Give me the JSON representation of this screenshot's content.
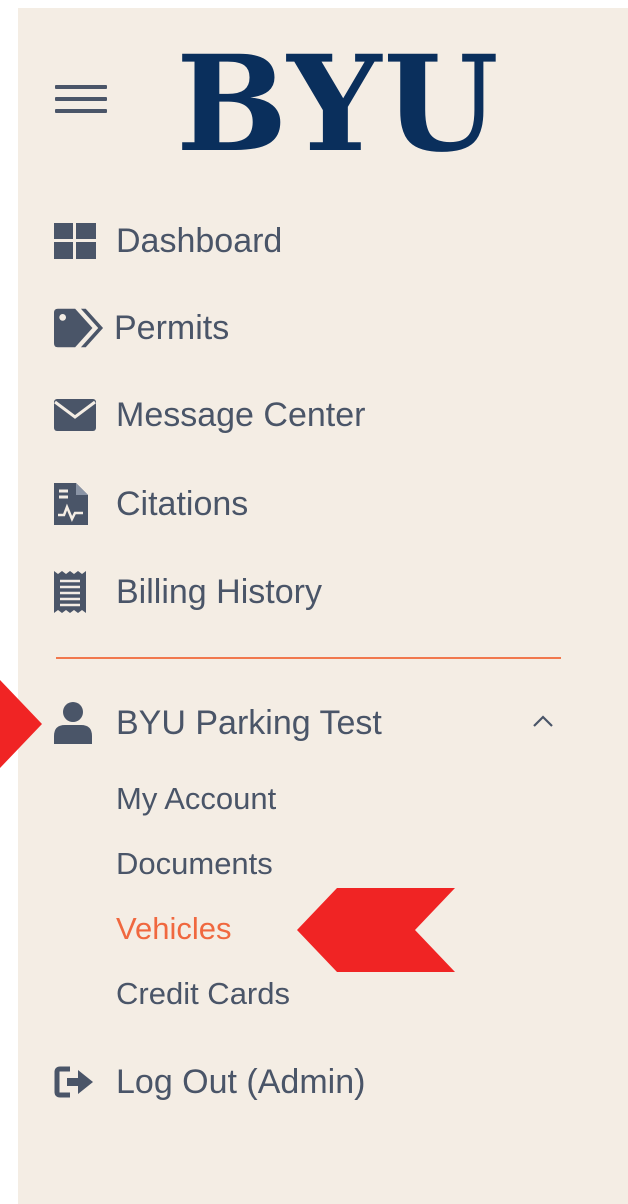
{
  "header": {
    "logo_text": "BYU",
    "brand_color": "#0a2f5c"
  },
  "nav": {
    "items": [
      {
        "label": "Dashboard",
        "icon": "dashboard-icon"
      },
      {
        "label": "Permits",
        "icon": "tags-icon"
      },
      {
        "label": "Message Center",
        "icon": "envelope-icon"
      },
      {
        "label": "Citations",
        "icon": "citation-document-icon"
      },
      {
        "label": "Billing History",
        "icon": "receipt-icon"
      }
    ]
  },
  "account": {
    "name": "BYU Parking Test",
    "icon": "user-icon",
    "expanded": true,
    "sub_items": [
      {
        "label": "My Account"
      },
      {
        "label": "Documents"
      },
      {
        "label": "Vehicles",
        "active": true
      },
      {
        "label": "Credit Cards"
      }
    ]
  },
  "logout": {
    "label": "Log Out (Admin)",
    "icon": "sign-out-icon"
  },
  "colors": {
    "background": "#f4ede4",
    "text": "#4a5568",
    "accent": "#f0683f",
    "divider": "#f1784d",
    "annotation_arrow": "#f02424"
  }
}
